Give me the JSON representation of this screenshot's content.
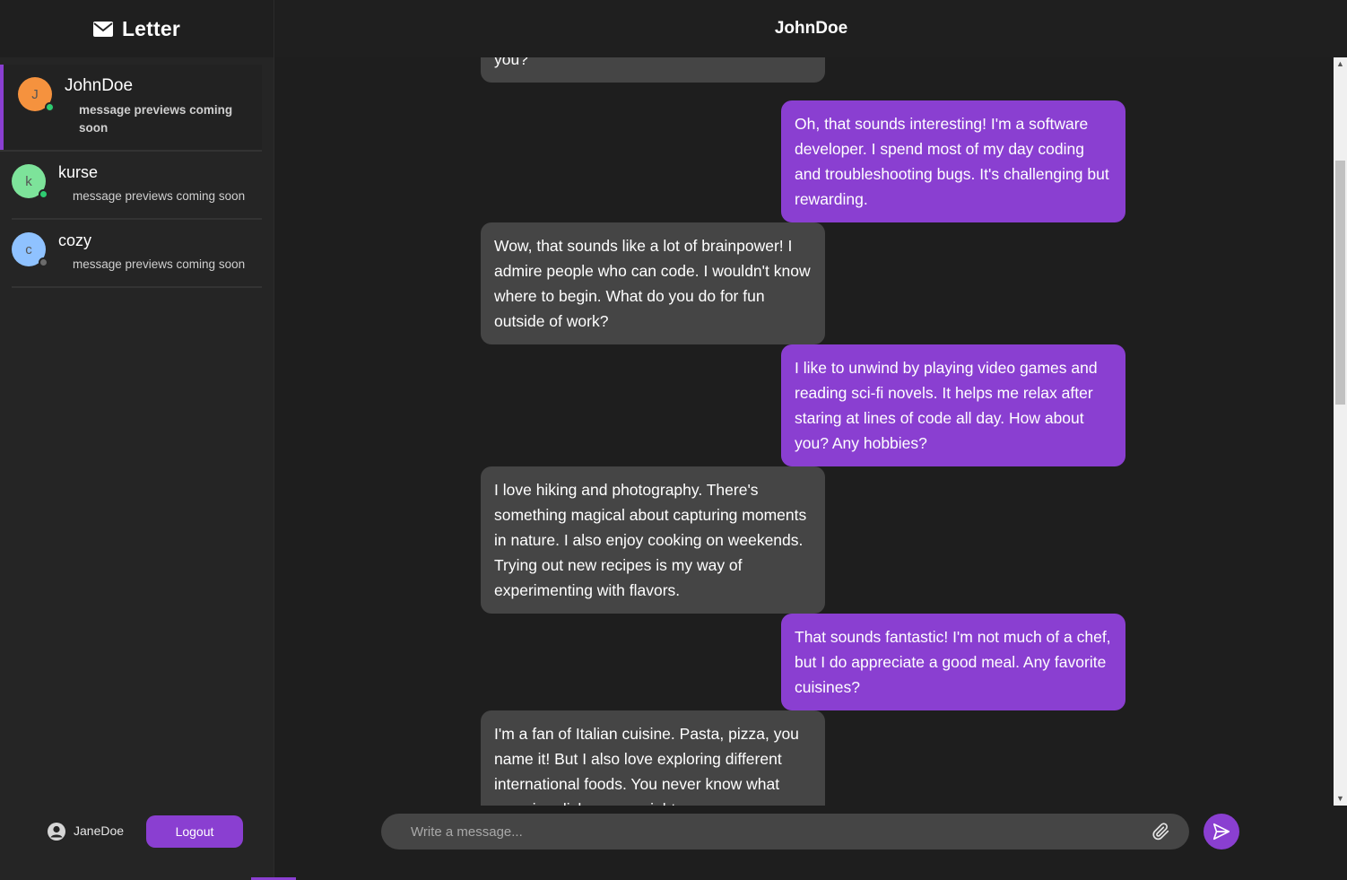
{
  "brand": {
    "name": "Letter",
    "icon": "envelope-icon"
  },
  "contacts": [
    {
      "name": "JohnDoe",
      "initial": "J",
      "preview": "message previews coming soon",
      "avatar_color": "#f5923e",
      "status_color": "#2ecc71",
      "active": true
    },
    {
      "name": "kurse",
      "initial": "k",
      "preview": "message previews coming soon",
      "avatar_color": "#7de39a",
      "status_color": "#2ecc71",
      "active": false
    },
    {
      "name": "cozy",
      "initial": "c",
      "preview": "message previews coming soon",
      "avatar_color": "#8fc2ff",
      "status_color": "#6b6b6b",
      "active": false
    }
  ],
  "current_user": {
    "name": "JaneDoe",
    "icon": "user-circle-icon"
  },
  "logout_label": "Logout",
  "chat": {
    "title": "JohnDoe",
    "messages": [
      {
        "direction": "in",
        "text": "you?"
      },
      {
        "direction": "out",
        "text": "Oh, that sounds interesting! I'm a software developer. I spend most of my day coding and troubleshooting bugs. It's challenging but rewarding."
      },
      {
        "direction": "in",
        "text": "Wow, that sounds like a lot of brainpower! I admire people who can code. I wouldn't know where to begin. What do you do for fun outside of work?"
      },
      {
        "direction": "out",
        "text": "I like to unwind by playing video games and reading sci-fi novels. It helps me relax after staring at lines of code all day. How about you? Any hobbies?"
      },
      {
        "direction": "in",
        "text": "I love hiking and photography. There's something magical about capturing moments in nature. I also enjoy cooking on weekends. Trying out new recipes is my way of experimenting with flavors."
      },
      {
        "direction": "out",
        "text": "That sounds fantastic! I'm not much of a chef, but I do appreciate a good meal. Any favorite cuisines?"
      },
      {
        "direction": "in",
        "text": "I'm a fan of Italian cuisine. Pasta, pizza, you name it! But I also love exploring different international foods. You never know what amazing dishes you might"
      }
    ]
  },
  "composer": {
    "placeholder": "Write a message...",
    "attach_icon": "paperclip-icon",
    "send_icon": "send-icon"
  },
  "colors": {
    "accent": "#8a3fd1",
    "incoming_bubble": "#454545",
    "background": "#1e1e1e",
    "sidebar": "#252525"
  }
}
